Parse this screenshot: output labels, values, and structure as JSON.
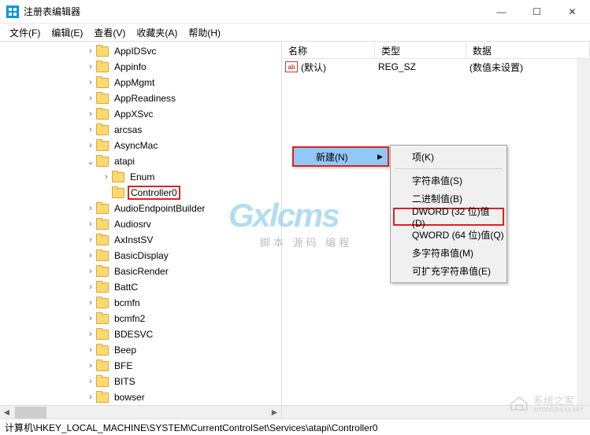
{
  "window": {
    "title": "注册表编辑器",
    "min": "—",
    "max": "☐",
    "close": "✕"
  },
  "menu": {
    "file": "文件(F)",
    "edit": "编辑(E)",
    "view": "查看(V)",
    "fav": "收藏夹(A)",
    "help": "帮助(H)"
  },
  "tree": [
    {
      "indent": 108,
      "exp": ">",
      "label": "AppIDSvc"
    },
    {
      "indent": 108,
      "exp": ">",
      "label": "Appinfo"
    },
    {
      "indent": 108,
      "exp": ">",
      "label": "AppMgmt"
    },
    {
      "indent": 108,
      "exp": ">",
      "label": "AppReadiness"
    },
    {
      "indent": 108,
      "exp": ">",
      "label": "AppXSvc"
    },
    {
      "indent": 108,
      "exp": ">",
      "label": "arcsas"
    },
    {
      "indent": 108,
      "exp": ">",
      "label": "AsyncMac"
    },
    {
      "indent": 108,
      "exp": "v",
      "label": "atapi"
    },
    {
      "indent": 128,
      "exp": ">",
      "label": "Enum"
    },
    {
      "indent": 128,
      "exp": "",
      "label": "Controller0",
      "hl": true
    },
    {
      "indent": 108,
      "exp": ">",
      "label": "AudioEndpointBuilder"
    },
    {
      "indent": 108,
      "exp": ">",
      "label": "Audiosrv"
    },
    {
      "indent": 108,
      "exp": ">",
      "label": "AxInstSV"
    },
    {
      "indent": 108,
      "exp": ">",
      "label": "BasicDisplay"
    },
    {
      "indent": 108,
      "exp": ">",
      "label": "BasicRender"
    },
    {
      "indent": 108,
      "exp": ">",
      "label": "BattC"
    },
    {
      "indent": 108,
      "exp": ">",
      "label": "bcmfn"
    },
    {
      "indent": 108,
      "exp": ">",
      "label": "bcmfn2"
    },
    {
      "indent": 108,
      "exp": ">",
      "label": "BDESVC"
    },
    {
      "indent": 108,
      "exp": ">",
      "label": "Beep"
    },
    {
      "indent": 108,
      "exp": ">",
      "label": "BFE"
    },
    {
      "indent": 108,
      "exp": ">",
      "label": "BITS"
    },
    {
      "indent": 108,
      "exp": ">",
      "label": "bowser"
    }
  ],
  "list": {
    "headers": {
      "name": "名称",
      "type": "类型",
      "data": "数据"
    },
    "rows": [
      {
        "icon": "ab",
        "name": "(默认)",
        "type": "REG_SZ",
        "data": "(数值未设置)"
      }
    ]
  },
  "context1": {
    "new": "新建(N)"
  },
  "context2": {
    "key": "项(K)",
    "string": "字符串值(S)",
    "binary": "二进制值(B)",
    "dword": "DWORD (32 位)值(D)",
    "qword": "QWORD (64 位)值(Q)",
    "multi": "多字符串值(M)",
    "expand": "可扩充字符串值(E)"
  },
  "statusbar": "计算机\\HKEY_LOCAL_MACHINE\\SYSTEM\\CurrentControlSet\\Services\\atapi\\Controller0",
  "watermark": {
    "main": "Gxlcms",
    "sub": "脚本 源码 编程",
    "corner": "系统之家",
    "corner_url": "XITONGZHIJIA.NET"
  }
}
